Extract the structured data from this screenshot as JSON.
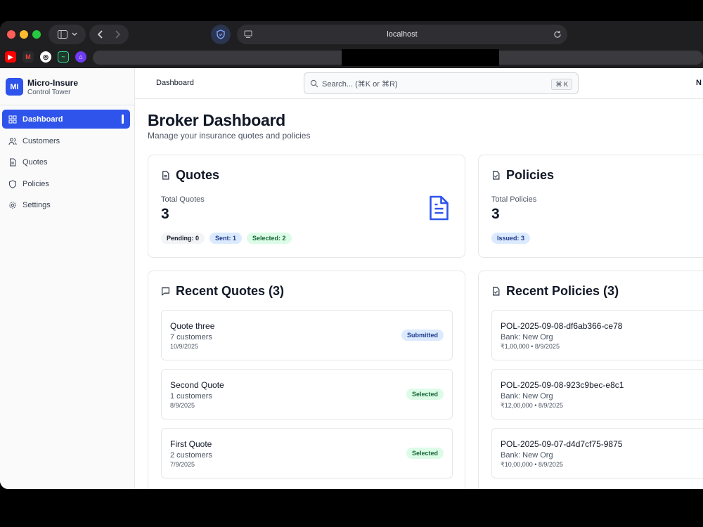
{
  "browser": {
    "url": "localhost"
  },
  "bookmarks": [
    {
      "icon": "youtube-icon"
    },
    {
      "icon": "gmail-icon"
    },
    {
      "icon": "chatgpt-icon"
    },
    {
      "icon": "activity-icon"
    },
    {
      "icon": "home-icon"
    }
  ],
  "brand": {
    "logo": "MI",
    "name": "Micro-Insure",
    "subtitle": "Control Tower"
  },
  "sidebar": {
    "items": [
      {
        "label": "Dashboard",
        "icon": "dashboard-icon",
        "active": true
      },
      {
        "label": "Customers",
        "icon": "users-icon"
      },
      {
        "label": "Quotes",
        "icon": "file-icon"
      },
      {
        "label": "Policies",
        "icon": "shield-icon"
      },
      {
        "label": "Settings",
        "icon": "gear-icon"
      }
    ]
  },
  "topbar": {
    "breadcrumb": "Dashboard",
    "search_placeholder": "Search... (⌘K or ⌘R)",
    "shortcut": "⌘ K",
    "right_text": "N"
  },
  "page": {
    "title": "Broker Dashboard",
    "subtitle": "Manage your insurance quotes and policies"
  },
  "quotes_card": {
    "title": "Quotes",
    "stat_label": "Total Quotes",
    "stat_value": "3",
    "badges": [
      "Pending: 0",
      "Sent: 1",
      "Selected: 2"
    ]
  },
  "policies_card": {
    "title": "Policies",
    "stat_label": "Total Policies",
    "stat_value": "3",
    "badges": [
      "Issued: 3"
    ]
  },
  "recent_quotes": {
    "title": "Recent Quotes (3)",
    "items": [
      {
        "title": "Quote three",
        "sub": "7 customers",
        "meta": "10/9/2025",
        "status": "Submitted"
      },
      {
        "title": "Second Quote",
        "sub": "1 customers",
        "meta": "8/9/2025",
        "status": "Selected"
      },
      {
        "title": "First Quote",
        "sub": "2 customers",
        "meta": "7/9/2025",
        "status": "Selected"
      }
    ]
  },
  "recent_policies": {
    "title": "Recent Policies (3)",
    "items": [
      {
        "title": "POL-2025-09-08-df6ab366-ce78",
        "sub": "Bank: New Org",
        "meta": "₹1,00,000 • 8/9/2025"
      },
      {
        "title": "POL-2025-09-08-923c9bec-e8c1",
        "sub": "Bank: New Org",
        "meta": "₹12,00,000 • 8/9/2025"
      },
      {
        "title": "POL-2025-09-07-d4d7cf75-9875",
        "sub": "Bank: New Org",
        "meta": "₹10,00,000 • 8/9/2025"
      }
    ]
  },
  "colors": {
    "accent": "#2f54eb",
    "submitted_badge": "#dbeafe",
    "selected_badge": "#dcfce7"
  }
}
